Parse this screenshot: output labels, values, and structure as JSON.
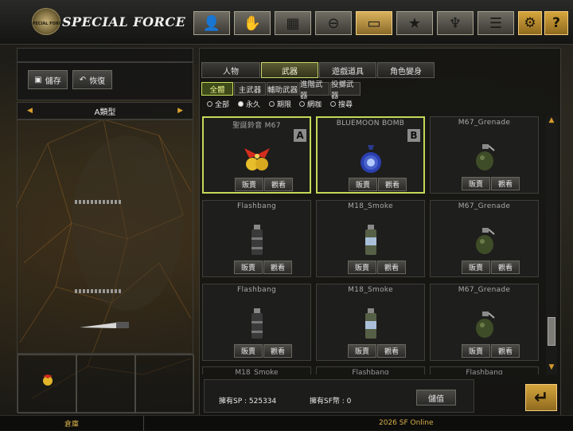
{
  "brand": {
    "title": "SPECIAL FORCE",
    "emblem_text": "SPECIAL FORCE"
  },
  "top_icons": [
    {
      "name": "character-icon",
      "glyph": "👤",
      "active": false
    },
    {
      "name": "grenade-icon",
      "glyph": "✋",
      "active": false
    },
    {
      "name": "vest-icon",
      "glyph": "▦",
      "active": false
    },
    {
      "name": "medal-icon",
      "glyph": "⊖",
      "active": false
    },
    {
      "name": "storage-box-icon",
      "glyph": "▭",
      "active": true
    },
    {
      "name": "star-badge-icon",
      "glyph": "★",
      "active": false
    },
    {
      "name": "eagle-icon",
      "glyph": "♆",
      "active": false
    },
    {
      "name": "document-icon",
      "glyph": "☰",
      "active": false
    }
  ],
  "settings_glyph": "⚙",
  "help_glyph": "?",
  "left": {
    "save_label": "儲存",
    "restore_label": "恢復",
    "type_label": "A類型",
    "arrow_left": "◀",
    "arrow_right": "▶"
  },
  "main_tabs": [
    {
      "label": "人物",
      "active": false
    },
    {
      "label": "武器",
      "active": true
    },
    {
      "label": "遊戲道具",
      "active": false
    },
    {
      "label": "角色變身",
      "active": false
    }
  ],
  "sub_tabs": [
    {
      "label": "全體",
      "active": true
    },
    {
      "label": "主武器",
      "active": false
    },
    {
      "label": "輔助武器",
      "active": false
    },
    {
      "label": "進階武器",
      "active": false
    },
    {
      "label": "投擲武器",
      "active": false
    }
  ],
  "filters": [
    {
      "label": "全部",
      "selected": false
    },
    {
      "label": "永久",
      "selected": true
    },
    {
      "label": "期限",
      "selected": false
    },
    {
      "label": "網咖",
      "selected": false
    },
    {
      "label": "搜尋",
      "selected": false
    }
  ],
  "item_buttons": {
    "sell": "販賣",
    "view": "觀看"
  },
  "items": [
    {
      "name": "聖誕鈴音 M67",
      "tag": "A",
      "selected": true,
      "art": "bell-icon"
    },
    {
      "name": "BLUEMOON BOMB",
      "tag": "B",
      "selected": true,
      "art": "blue-bomb-icon"
    },
    {
      "name": "M67_Grenade",
      "tag": "",
      "selected": false,
      "art": "frag-grenade-icon"
    },
    {
      "name": "Flashbang",
      "tag": "",
      "selected": false,
      "art": "flashbang-icon"
    },
    {
      "name": "M18_Smoke",
      "tag": "",
      "selected": false,
      "art": "smoke-grenade-icon"
    },
    {
      "name": "M67_Grenade",
      "tag": "",
      "selected": false,
      "art": "frag-grenade-icon"
    },
    {
      "name": "Flashbang",
      "tag": "",
      "selected": false,
      "art": "flashbang-icon"
    },
    {
      "name": "M18_Smoke",
      "tag": "",
      "selected": false,
      "art": "smoke-grenade-icon"
    },
    {
      "name": "M67_Grenade",
      "tag": "",
      "selected": false,
      "art": "frag-grenade-icon"
    }
  ],
  "partial_row": [
    "M18_Smoke",
    "Flashbang",
    "Flashbang"
  ],
  "scroll": {
    "up": "▲",
    "down": "▼"
  },
  "footer": {
    "sp_label": "擁有SP : 525334",
    "sf_label": "擁有SF幣 : 0",
    "deposit_button": "儲值",
    "enter_glyph": "↵",
    "warehouse": "倉庫",
    "copyright": "2026 SF Online"
  },
  "colors": {
    "accent": "#c6d957",
    "gold": "#d6a53d"
  }
}
